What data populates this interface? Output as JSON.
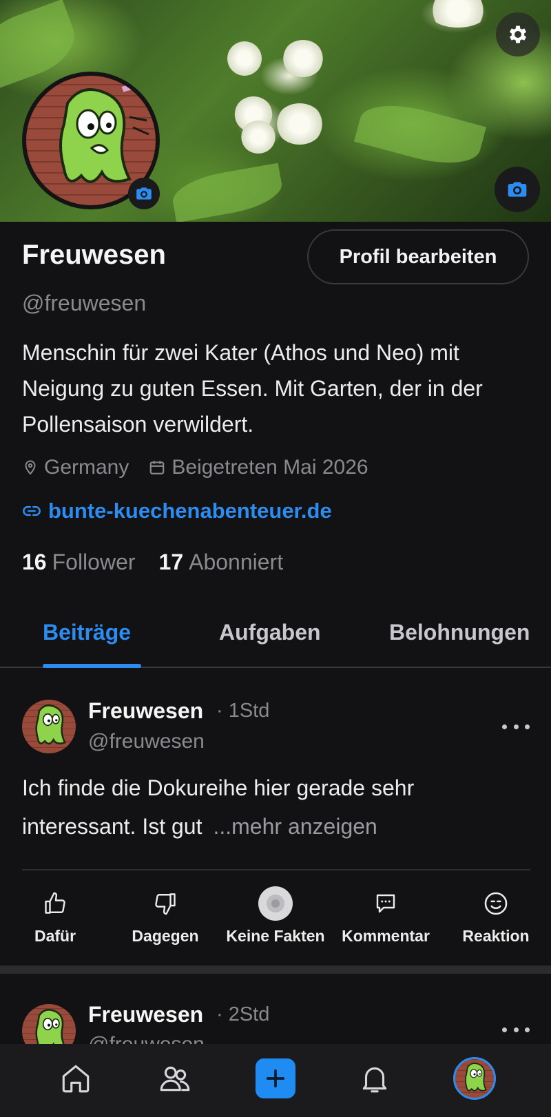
{
  "profile": {
    "name": "Freuwesen",
    "edit_button": "Profil bearbeiten",
    "handle": "@freuwesen",
    "bio": "Menschin für zwei Kater (Athos und Neo) mit Neigung zu guten Essen. Mit Garten, der in der Pollensaison verwildert.",
    "location": "Germany",
    "joined": "Beigetreten Mai 2026",
    "website": "bunte-kuechenabenteuer.de",
    "followers_count": "16",
    "followers_label": "Follower",
    "following_count": "17",
    "following_label": "Abonniert"
  },
  "tabs": [
    {
      "label": "Beiträge",
      "active": true
    },
    {
      "label": "Aufgaben",
      "active": false
    },
    {
      "label": "Belohnungen",
      "active": false
    }
  ],
  "posts": [
    {
      "author": "Freuwesen",
      "time": "· 1Std",
      "handle": "@freuwesen",
      "text": "Ich finde die Dokureihe hier gerade sehr interessant. Ist gut",
      "more": "...mehr anzeigen"
    },
    {
      "author": "Freuwesen",
      "time": "· 2Std",
      "handle": "@freuwesen"
    }
  ],
  "actions": [
    {
      "label": "Dafür",
      "icon": "thumbs-up-icon"
    },
    {
      "label": "Dagegen",
      "icon": "thumbs-down-icon"
    },
    {
      "label": "Keine Fakten",
      "icon": "no-facts-icon"
    },
    {
      "label": "Kommentar",
      "icon": "comment-icon"
    },
    {
      "label": "Reaktion",
      "icon": "smile-icon"
    }
  ],
  "nav": [
    "home-icon",
    "community-icon",
    "add-icon",
    "bell-icon",
    "profile-avatar"
  ],
  "colors": {
    "accent": "#2c8cf0",
    "background": "#121214",
    "muted_text": "#8a8a8e"
  }
}
